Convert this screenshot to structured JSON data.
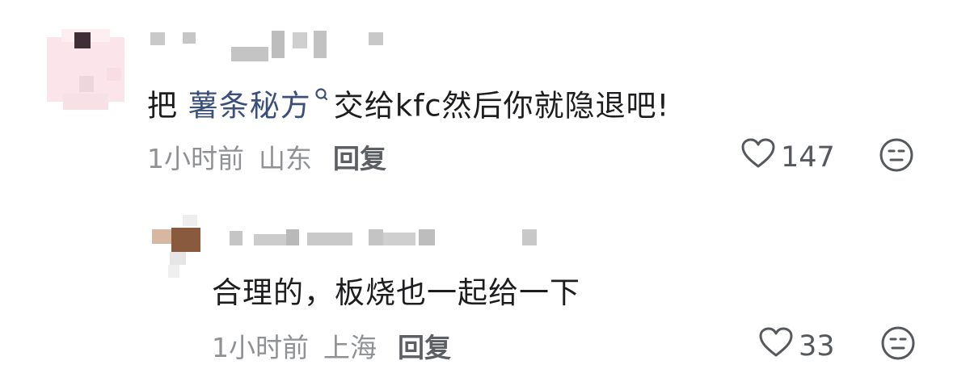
{
  "comments": [
    {
      "text_prefix": "把 ",
      "link_text": "薯条秘方",
      "text_suffix": "交给kfc然后你就隐退吧!",
      "time": "1小时前",
      "location": "山东",
      "reply_label": "回复",
      "likes": "147"
    },
    {
      "text": "合理的，板烧也一起给一下",
      "time": "1小时前",
      "location": "上海",
      "reply_label": "回复",
      "likes": "33"
    }
  ],
  "icons": {
    "like": "heart-outline-icon",
    "reaction": "neutral-face-icon",
    "search": "search-icon"
  },
  "colors": {
    "link": "#3a4f7a",
    "text": "#1d1d1f",
    "meta": "#8f9194"
  }
}
